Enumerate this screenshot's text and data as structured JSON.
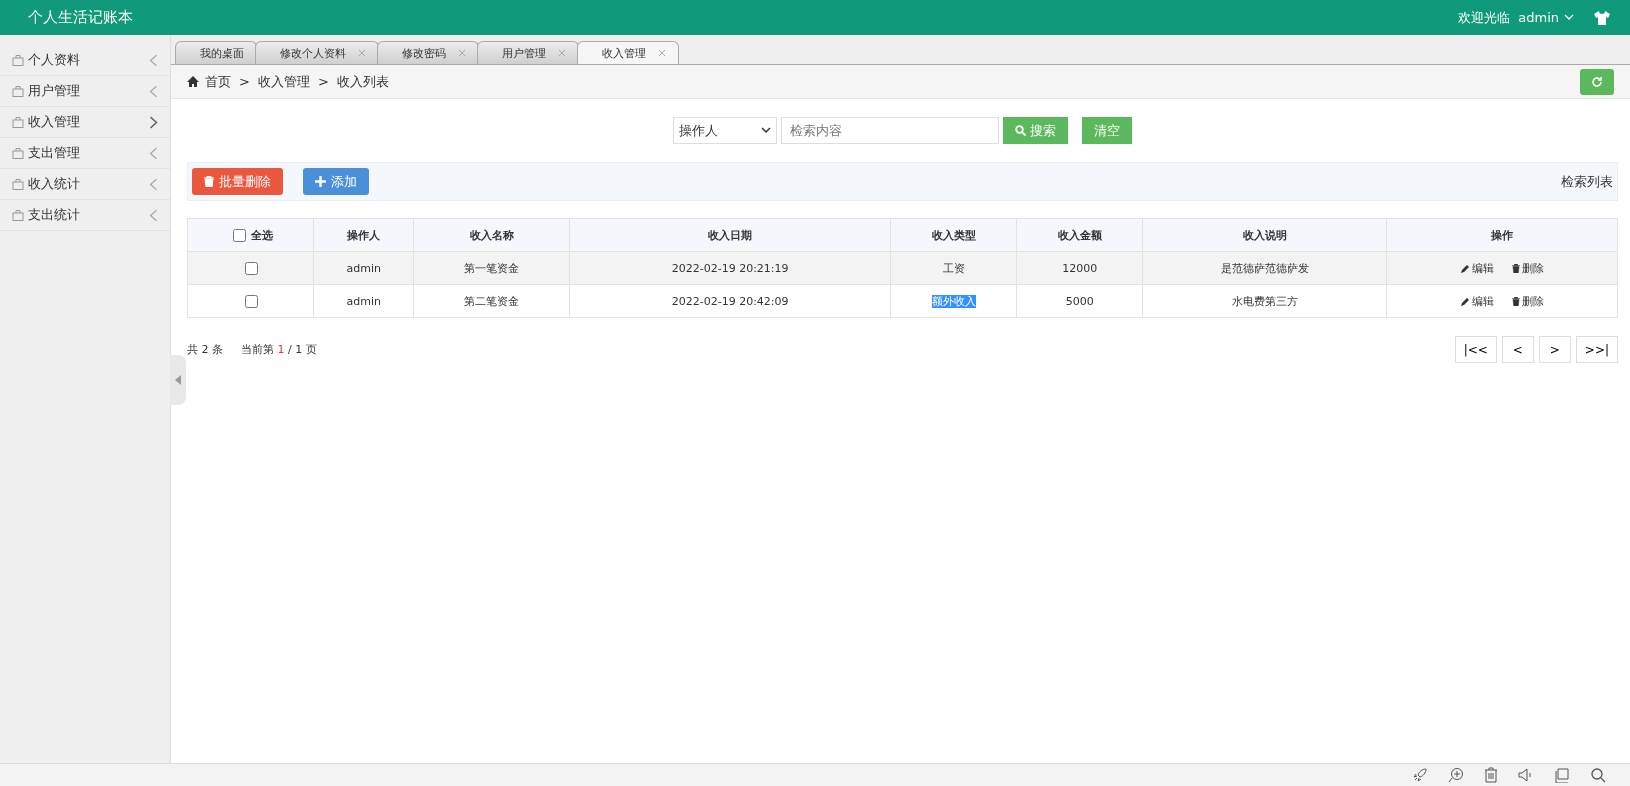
{
  "header": {
    "title": "个人生活记账本",
    "welcome": "欢迎光临",
    "user": "admin"
  },
  "sidebar": {
    "items": [
      {
        "label": "个人资料",
        "selected": false
      },
      {
        "label": "用户管理",
        "selected": false
      },
      {
        "label": "收入管理",
        "selected": true
      },
      {
        "label": "支出管理",
        "selected": false
      },
      {
        "label": "收入统计",
        "selected": false
      },
      {
        "label": "支出统计",
        "selected": false
      }
    ]
  },
  "tabs": [
    {
      "label": "我的桌面",
      "closable": false,
      "selected": false
    },
    {
      "label": "修改个人资料",
      "closable": true,
      "selected": false
    },
    {
      "label": "修改密码",
      "closable": true,
      "selected": false
    },
    {
      "label": "用户管理",
      "closable": true,
      "selected": false
    },
    {
      "label": "收入管理",
      "closable": true,
      "selected": true
    }
  ],
  "breadcrumb": {
    "separator": ">",
    "items": [
      "首页",
      "收入管理",
      "收入列表"
    ]
  },
  "search": {
    "field": "操作人",
    "placeholder": "检索内容",
    "search_button": "搜索",
    "clear_button": "清空"
  },
  "toolbar": {
    "batch_delete": "批量删除",
    "add": "添加",
    "caption": "检索列表"
  },
  "table": {
    "select_all": "全选",
    "select_all_checked": false,
    "columns": [
      "操作人",
      "收入名称",
      "收入日期",
      "收入类型",
      "收入金额",
      "收入说明",
      "操作"
    ],
    "rows": [
      {
        "checked": false,
        "hovered": true,
        "type_selected": false,
        "cells": [
          "admin",
          "第一笔资金",
          "2022-02-19 20:21:19",
          "工资",
          "12000",
          "是范德萨范德萨发"
        ],
        "edit": "编辑",
        "delete": "删除"
      },
      {
        "checked": false,
        "hovered": false,
        "type_selected": true,
        "cells": [
          "admin",
          "第二笔资金",
          "2022-02-19 20:42:09",
          "额外收入",
          "5000",
          "水电费第三方"
        ],
        "edit": "编辑",
        "delete": "删除"
      }
    ]
  },
  "pagination": {
    "total_prefix": "共",
    "total": "2",
    "total_suffix": "条",
    "current_prefix": "当前第",
    "current": "1",
    "of": "/ 1",
    "page_suffix": "页",
    "buttons": [
      "|<<",
      "<",
      ">",
      ">>|"
    ]
  }
}
